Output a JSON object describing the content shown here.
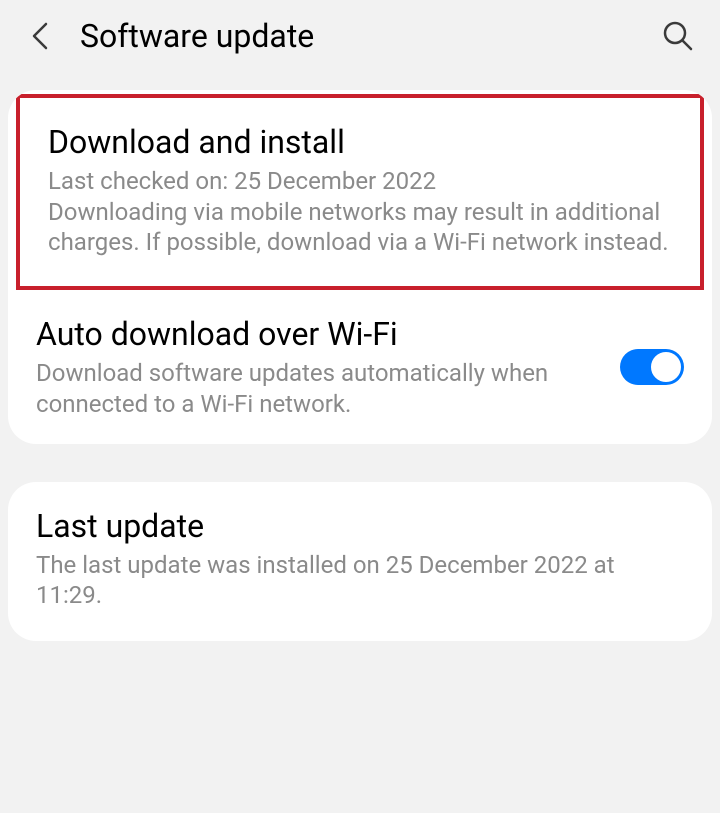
{
  "header": {
    "title": "Software update"
  },
  "download_install": {
    "title": "Download and install",
    "desc": "Last checked on: 25 December 2022\nDownloading via mobile networks may result in additional charges. If possible, download via a Wi-Fi network instead."
  },
  "auto_download": {
    "title": "Auto download over Wi-Fi",
    "desc": "Download software updates automatically when connected to a Wi-Fi network.",
    "enabled": true
  },
  "last_update": {
    "title": "Last update",
    "desc": "The last update was installed on 25 December 2022 at 11:29."
  },
  "colors": {
    "highlight_border": "#c8202c",
    "toggle_on": "#0078ff"
  }
}
